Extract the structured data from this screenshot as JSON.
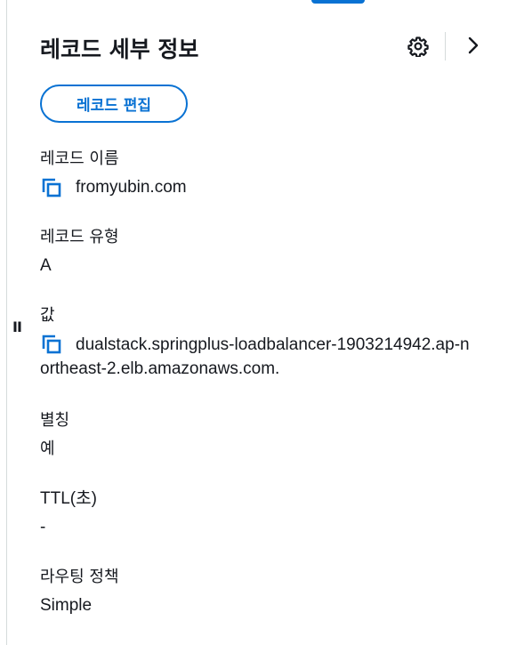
{
  "panel": {
    "title": "레코드 세부 정보",
    "edit_button_label": "레코드 편집",
    "icons": {
      "settings": "gear-icon",
      "collapse": "chevron-right-icon",
      "copy": "copy-icon",
      "resize": "resize-handle-icon"
    },
    "colors": {
      "accent": "#0972d3",
      "text": "#16191f",
      "divider": "#d5dbdb"
    }
  },
  "fields": {
    "record_name": {
      "label": "레코드 이름",
      "value": "fromyubin.com"
    },
    "record_type": {
      "label": "레코드 유형",
      "value": "A"
    },
    "value": {
      "label": "값",
      "value": "dualstack.springplus-loadbalancer-1903214942.ap-northeast-2.elb.amazonaws.com."
    },
    "alias": {
      "label": "별칭",
      "value": "예"
    },
    "ttl": {
      "label": "TTL(초)",
      "value": "-"
    },
    "routing_policy": {
      "label": "라우팅 정책",
      "value": "Simple"
    }
  }
}
